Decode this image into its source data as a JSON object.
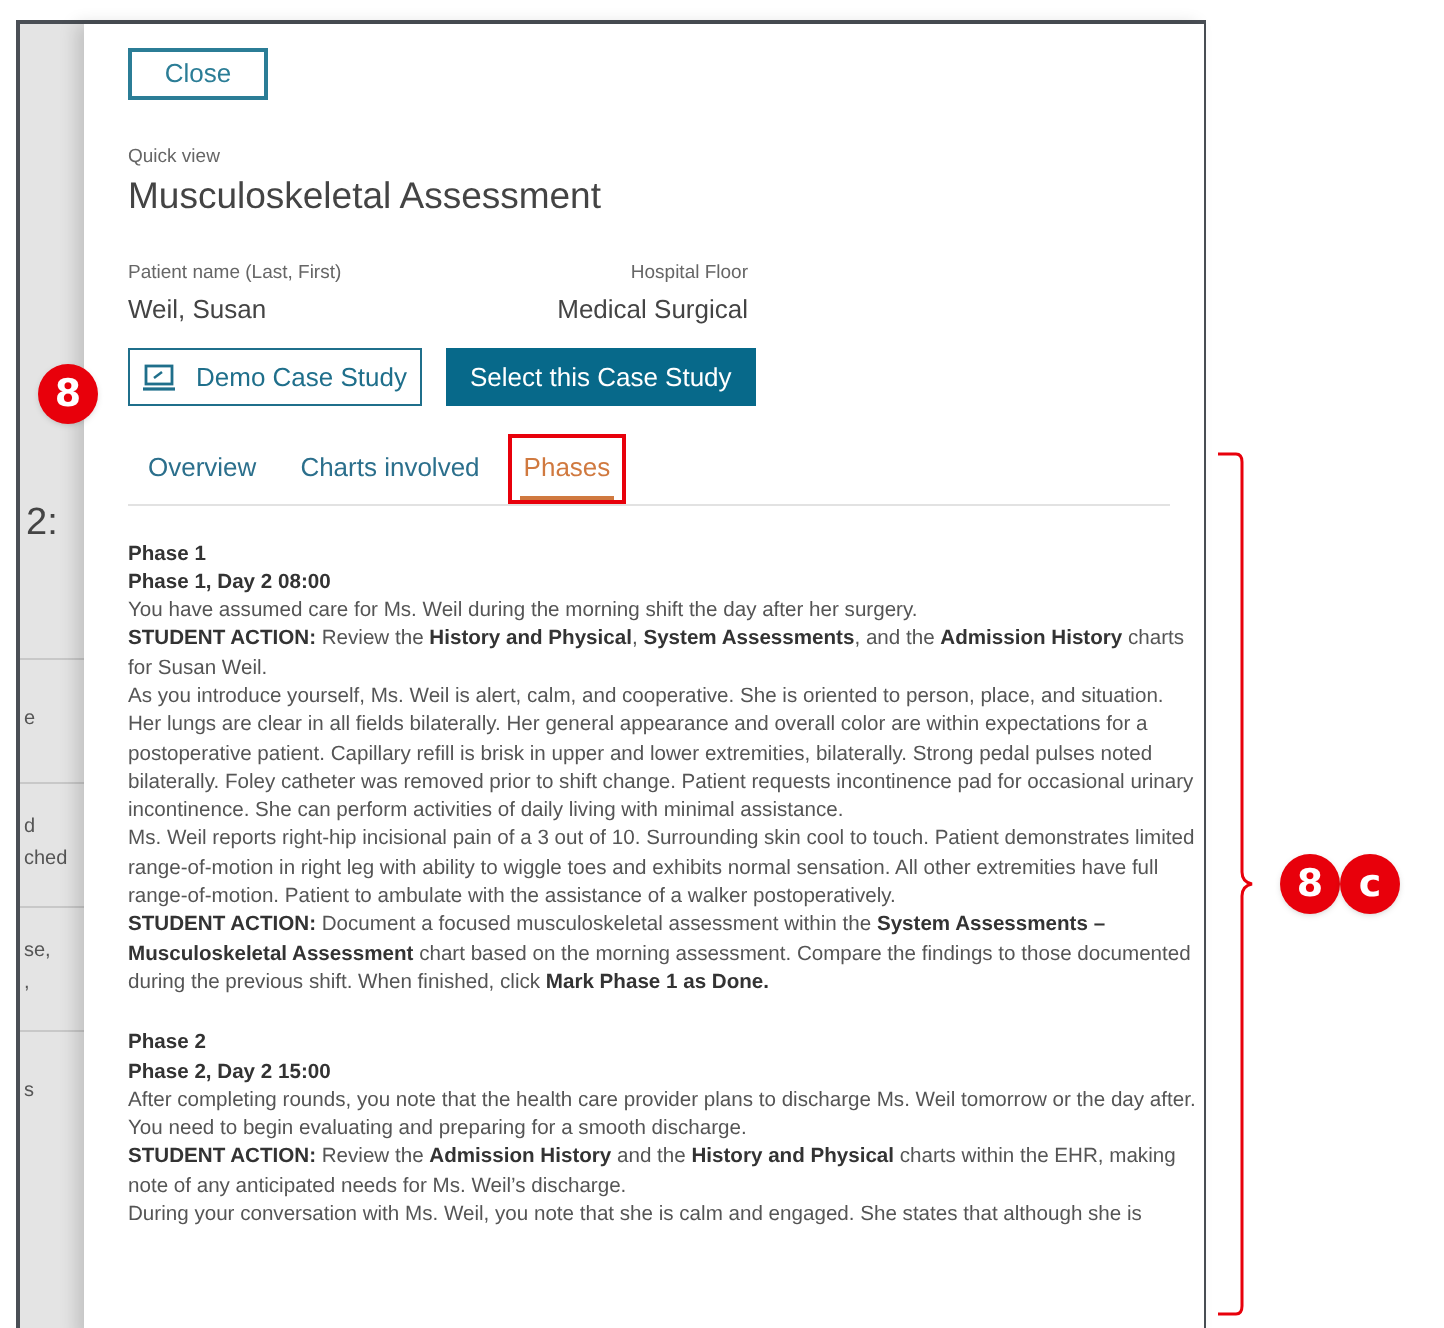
{
  "background": {
    "heading": "2:",
    "fragments": [
      {
        "lines": [
          "e"
        ]
      },
      {
        "lines": [
          "d",
          "ched"
        ]
      },
      {
        "lines": [
          "se,",
          ","
        ]
      },
      {
        "lines": [
          "s"
        ]
      }
    ]
  },
  "panel": {
    "close_button": "Close",
    "eyebrow": "Quick view",
    "title": "Musculoskeletal Assessment",
    "fields": [
      {
        "label": "Patient name (Last, First)",
        "value": "Weil, Susan"
      },
      {
        "label": "Hospital Floor",
        "value": "Medical Surgical"
      }
    ],
    "buttons": [
      {
        "kind": "outline",
        "label": "Demo Case Study"
      },
      {
        "kind": "primary",
        "label": "Select this Case Study"
      }
    ],
    "tabs": [
      {
        "label": "Overview",
        "selected": false,
        "highlighted": false
      },
      {
        "label": "Charts involved",
        "selected": false,
        "highlighted": false
      },
      {
        "label": "Phases",
        "selected": true,
        "highlighted": true
      }
    ],
    "phases": [
      {
        "title": "Phase 1",
        "subtitle": "Phase 1, Day 2 08:00",
        "paragraphs": [
          "You have assumed care for Ms. Weil during the morning shift the day after her surgery.",
          "**STUDENT ACTION:** Review the **History and Physical**, **System Assessments**, and the **Admission History** charts for Susan Weil.",
          "As you introduce yourself, Ms. Weil is alert, calm, and cooperative. She is oriented to person, place, and situation. Her lungs are clear in all fields bilaterally. Her general appearance and overall color are within expectations for a postoperative patient. Capillary refill is brisk in upper and lower extremities, bilaterally. Strong pedal pulses noted bilaterally. Foley catheter was removed prior to shift change. Patient requests incontinence pad for occasional urinary incontinence. She can perform activities of daily living with minimal assistance.",
          "Ms. Weil reports right-hip incisional pain of a 3 out of 10. Surrounding skin cool to touch. Patient demonstrates limited range-of-motion in right leg with ability to wiggle toes and exhibits normal sensation. All other extremities have full range-of-motion. Patient to ambulate with the assistance of a walker postoperatively.",
          "**STUDENT ACTION:** Document a focused musculoskeletal assessment within the **System Assessments – Musculoskeletal Assessment** chart based on the morning assessment. Compare the findings to those documented during the previous shift. When finished, click **Mark Phase 1 as Done.**"
        ]
      },
      {
        "title": "Phase 2",
        "subtitle": "Phase 2, Day 2 15:00",
        "paragraphs": [
          "After completing rounds, you note that the health care provider plans to discharge Ms. Weil tomorrow or the day after. You need to begin evaluating and preparing for a smooth discharge.",
          "**STUDENT ACTION:** Review the **Admission History** and the **History and Physical** charts within the EHR, making note of any anticipated needs for Ms. Weil’s discharge.",
          "During your conversation with Ms. Weil, you note that she is calm and engaged. She states that although she is"
        ]
      }
    ]
  },
  "annotations": [
    {
      "kind": "badge",
      "labels": [
        "8"
      ]
    },
    {
      "kind": "bracket",
      "labels": [
        "8",
        "c"
      ]
    }
  ]
}
